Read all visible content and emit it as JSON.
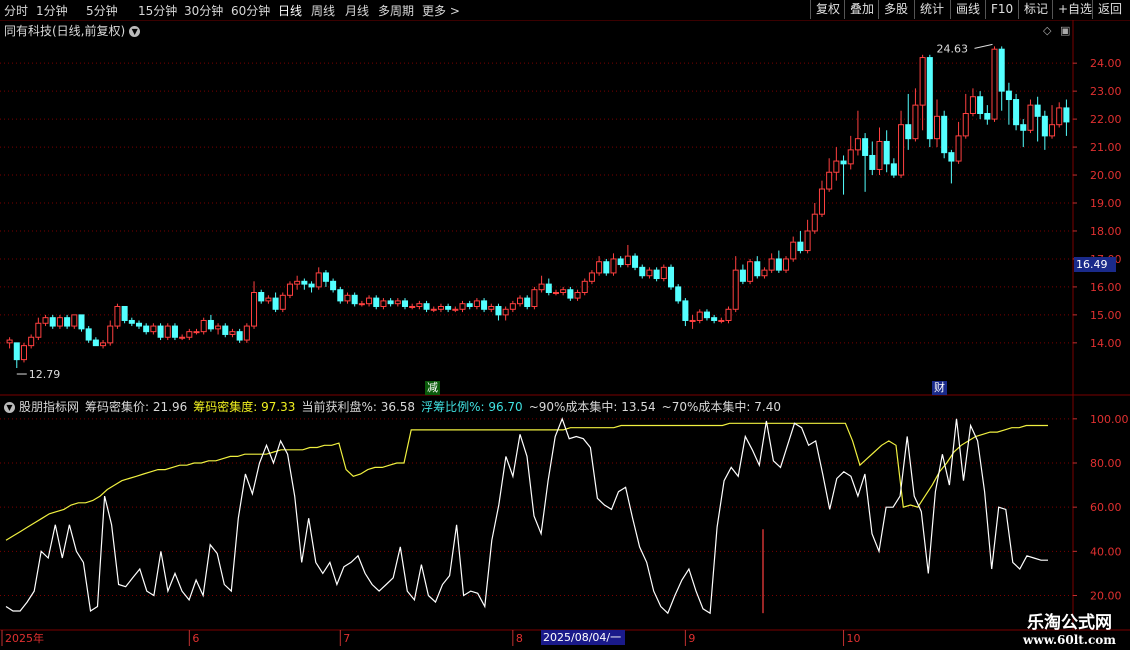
{
  "toolbar": {
    "periods": [
      "分时",
      "1分钟",
      "5分钟",
      "15分钟",
      "30分钟",
      "60分钟",
      "日线",
      "周线",
      "月线",
      "多周期",
      "更多 >"
    ],
    "active_index": 6,
    "right_buttons": [
      "复权",
      "叠加",
      "多股",
      "统计",
      "画线",
      "F10",
      "标记",
      "+自选",
      "返回"
    ]
  },
  "header": {
    "title": "同有科技(日线,前复权)",
    "chevron": "chevron-down-icon"
  },
  "markers": {
    "jian": "减",
    "cai": "财",
    "high_label": "24.63",
    "low_label": "12.79"
  },
  "price_tag": "16.49",
  "indicator": {
    "name": "股朋指标网",
    "items": [
      {
        "label": "筹码密集价: 21.96",
        "color": "#d8d8d8"
      },
      {
        "label": "筹码密集度: 97.33",
        "color": "#f0f020"
      },
      {
        "label": "当前获利盘%: 36.58",
        "color": "#d8d8d8"
      },
      {
        "label": "浮筹比例%: 96.70",
        "color": "#40e0e0"
      },
      {
        "label": "~90%成本集中: 13.54",
        "color": "#d8d8d8"
      },
      {
        "label": "~70%成本集中: 7.40",
        "color": "#d8d8d8"
      }
    ]
  },
  "date_box": "2025/08/04/一",
  "watermark": {
    "line1": "乐淘公式网",
    "line2": "www.60lt.com"
  },
  "colors": {
    "up": "#ff4040",
    "down": "#54ffff",
    "grid": "#7a0000",
    "yellow": "#f0f040",
    "white": "#ffffff"
  },
  "chart_data": [
    {
      "type": "candlestick",
      "title": "同有科技(日线,前复权)",
      "y_ticks": [
        14.0,
        15.0,
        16.0,
        17.0,
        18.0,
        19.0,
        20.0,
        21.0,
        22.0,
        23.0,
        24.0
      ],
      "ylim": [
        12.6,
        24.9
      ],
      "x_ticks": [
        "2025年",
        "6",
        "7",
        "8",
        "9",
        "10"
      ],
      "x_tick_index": [
        0,
        25,
        46,
        70,
        94,
        116
      ],
      "candles": [
        [
          14.0,
          14.1,
          13.8,
          14.2
        ],
        [
          14.0,
          13.4,
          13.1,
          14.0
        ],
        [
          13.4,
          13.9,
          13.3,
          14.0
        ],
        [
          13.9,
          14.2,
          13.8,
          14.3
        ],
        [
          14.2,
          14.7,
          14.1,
          14.9
        ],
        [
          14.7,
          14.9,
          14.6,
          15.0
        ],
        [
          14.9,
          14.6,
          14.5,
          15.0
        ],
        [
          14.6,
          14.9,
          14.5,
          15.0
        ],
        [
          14.9,
          14.6,
          14.5,
          15.0
        ],
        [
          14.6,
          15.0,
          14.5,
          15.0
        ],
        [
          15.0,
          14.5,
          14.4,
          15.0
        ],
        [
          14.5,
          14.1,
          14.0,
          14.6
        ],
        [
          14.1,
          13.9,
          13.9,
          14.2
        ],
        [
          13.9,
          14.0,
          13.8,
          14.1
        ],
        [
          14.0,
          14.6,
          13.9,
          14.8
        ],
        [
          14.6,
          15.3,
          14.5,
          15.4
        ],
        [
          15.3,
          14.8,
          14.7,
          15.3
        ],
        [
          14.8,
          14.7,
          14.6,
          14.9
        ],
        [
          14.7,
          14.6,
          14.5,
          14.8
        ],
        [
          14.6,
          14.4,
          14.3,
          14.7
        ],
        [
          14.4,
          14.6,
          14.3,
          14.7
        ],
        [
          14.6,
          14.2,
          14.1,
          14.7
        ],
        [
          14.2,
          14.6,
          14.1,
          14.7
        ],
        [
          14.6,
          14.2,
          14.1,
          14.7
        ],
        [
          14.2,
          14.2,
          14.1,
          14.3
        ],
        [
          14.2,
          14.4,
          14.1,
          14.5
        ],
        [
          14.4,
          14.4,
          14.3,
          14.5
        ],
        [
          14.4,
          14.8,
          14.3,
          14.9
        ],
        [
          14.8,
          14.5,
          14.4,
          15.0
        ],
        [
          14.5,
          14.6,
          14.3,
          14.7
        ],
        [
          14.6,
          14.3,
          14.2,
          14.7
        ],
        [
          14.3,
          14.4,
          14.2,
          14.5
        ],
        [
          14.4,
          14.1,
          14.0,
          14.5
        ],
        [
          14.1,
          14.6,
          14.0,
          14.7
        ],
        [
          14.6,
          15.8,
          14.5,
          16.2
        ],
        [
          15.8,
          15.5,
          15.4,
          15.9
        ],
        [
          15.5,
          15.6,
          15.4,
          15.7
        ],
        [
          15.6,
          15.2,
          15.1,
          15.8
        ],
        [
          15.2,
          15.7,
          15.1,
          15.8
        ],
        [
          15.7,
          16.1,
          15.6,
          16.2
        ],
        [
          16.1,
          16.2,
          15.9,
          16.4
        ],
        [
          16.2,
          16.1,
          15.9,
          16.3
        ],
        [
          16.1,
          16.0,
          15.8,
          16.2
        ],
        [
          16.0,
          16.5,
          15.9,
          16.7
        ],
        [
          16.5,
          16.2,
          16.0,
          16.6
        ],
        [
          16.2,
          15.9,
          15.8,
          16.3
        ],
        [
          15.9,
          15.5,
          15.4,
          16.0
        ],
        [
          15.5,
          15.7,
          15.4,
          15.8
        ],
        [
          15.7,
          15.4,
          15.3,
          15.8
        ],
        [
          15.4,
          15.4,
          15.3,
          15.5
        ],
        [
          15.4,
          15.6,
          15.3,
          15.7
        ],
        [
          15.6,
          15.3,
          15.2,
          15.7
        ],
        [
          15.3,
          15.5,
          15.2,
          15.6
        ],
        [
          15.5,
          15.4,
          15.3,
          15.6
        ],
        [
          15.4,
          15.5,
          15.3,
          15.6
        ],
        [
          15.5,
          15.3,
          15.2,
          15.6
        ],
        [
          15.3,
          15.3,
          15.2,
          15.4
        ],
        [
          15.3,
          15.4,
          15.2,
          15.5
        ],
        [
          15.4,
          15.2,
          15.1,
          15.5
        ],
        [
          15.2,
          15.2,
          15.1,
          15.3
        ],
        [
          15.2,
          15.3,
          15.1,
          15.4
        ],
        [
          15.3,
          15.2,
          15.1,
          15.4
        ],
        [
          15.2,
          15.2,
          15.1,
          15.3
        ],
        [
          15.2,
          15.4,
          15.1,
          15.5
        ],
        [
          15.4,
          15.3,
          15.2,
          15.5
        ],
        [
          15.3,
          15.5,
          15.2,
          15.6
        ],
        [
          15.5,
          15.2,
          15.1,
          15.6
        ],
        [
          15.2,
          15.3,
          15.1,
          15.4
        ],
        [
          15.3,
          15.0,
          14.8,
          15.4
        ],
        [
          15.0,
          15.2,
          14.8,
          15.3
        ],
        [
          15.2,
          15.4,
          15.1,
          15.5
        ],
        [
          15.4,
          15.6,
          15.3,
          15.7
        ],
        [
          15.6,
          15.3,
          15.2,
          15.7
        ],
        [
          15.3,
          15.9,
          15.2,
          16.0
        ],
        [
          15.9,
          16.1,
          15.8,
          16.4
        ],
        [
          16.1,
          15.8,
          15.7,
          16.3
        ],
        [
          15.8,
          15.8,
          15.7,
          15.9
        ],
        [
          15.8,
          15.9,
          15.7,
          16.0
        ],
        [
          15.9,
          15.6,
          15.5,
          16.0
        ],
        [
          15.6,
          15.8,
          15.5,
          15.9
        ],
        [
          15.8,
          16.2,
          15.7,
          16.3
        ],
        [
          16.2,
          16.5,
          16.1,
          16.6
        ],
        [
          16.5,
          16.9,
          16.4,
          17.1
        ],
        [
          16.9,
          16.5,
          16.4,
          17.0
        ],
        [
          16.5,
          17.0,
          16.4,
          17.2
        ],
        [
          17.0,
          16.8,
          16.7,
          17.1
        ],
        [
          16.8,
          17.1,
          16.7,
          17.5
        ],
        [
          17.1,
          16.7,
          16.6,
          17.2
        ],
        [
          16.7,
          16.4,
          16.3,
          16.8
        ],
        [
          16.4,
          16.6,
          16.3,
          16.7
        ],
        [
          16.6,
          16.3,
          16.2,
          16.7
        ],
        [
          16.3,
          16.7,
          16.2,
          16.8
        ],
        [
          16.7,
          16.0,
          15.9,
          16.8
        ],
        [
          16.0,
          15.5,
          15.4,
          16.1
        ],
        [
          15.5,
          14.8,
          14.6,
          15.6
        ],
        [
          14.8,
          14.8,
          14.5,
          15.0
        ],
        [
          14.8,
          15.1,
          14.7,
          15.2
        ],
        [
          15.1,
          14.9,
          14.8,
          15.2
        ],
        [
          14.9,
          14.8,
          14.7,
          15.0
        ],
        [
          14.8,
          14.8,
          14.7,
          14.9
        ],
        [
          14.8,
          15.2,
          14.7,
          15.3
        ],
        [
          15.2,
          16.6,
          15.1,
          17.1
        ],
        [
          16.6,
          16.2,
          16.1,
          16.8
        ],
        [
          16.2,
          16.9,
          16.1,
          17.0
        ],
        [
          16.9,
          16.4,
          16.3,
          17.1
        ],
        [
          16.4,
          16.6,
          16.3,
          16.7
        ],
        [
          16.6,
          17.0,
          16.5,
          17.2
        ],
        [
          17.0,
          16.6,
          16.5,
          17.3
        ],
        [
          16.6,
          17.0,
          16.5,
          17.1
        ],
        [
          17.0,
          17.6,
          16.9,
          17.8
        ],
        [
          17.6,
          17.3,
          17.2,
          18.0
        ],
        [
          17.3,
          18.0,
          17.2,
          18.4
        ],
        [
          18.0,
          18.6,
          17.9,
          19.0
        ],
        [
          18.6,
          19.5,
          18.5,
          19.8
        ],
        [
          19.5,
          20.1,
          19.4,
          20.6
        ],
        [
          20.1,
          20.5,
          19.8,
          21.0
        ],
        [
          20.5,
          20.4,
          19.3,
          20.7
        ],
        [
          20.4,
          20.9,
          20.2,
          21.4
        ],
        [
          20.9,
          21.3,
          20.7,
          22.3
        ],
        [
          21.3,
          20.7,
          19.4,
          21.5
        ],
        [
          20.7,
          20.2,
          20.0,
          21.2
        ],
        [
          20.2,
          21.2,
          20.0,
          21.7
        ],
        [
          21.2,
          20.4,
          20.1,
          21.6
        ],
        [
          20.4,
          20.0,
          19.9,
          20.6
        ],
        [
          20.0,
          21.8,
          19.9,
          22.3
        ],
        [
          21.8,
          21.3,
          20.9,
          22.9
        ],
        [
          21.3,
          22.5,
          21.2,
          23.1
        ],
        [
          22.5,
          24.2,
          21.6,
          24.3
        ],
        [
          24.2,
          21.3,
          21.0,
          24.3
        ],
        [
          21.3,
          22.1,
          21.0,
          22.7
        ],
        [
          22.1,
          20.8,
          20.6,
          22.3
        ],
        [
          20.8,
          20.5,
          19.7,
          20.9
        ],
        [
          20.5,
          21.4,
          20.4,
          21.9
        ],
        [
          21.4,
          22.2,
          21.3,
          22.9
        ],
        [
          22.2,
          22.8,
          22.1,
          23.1
        ],
        [
          22.8,
          22.2,
          22.0,
          23.0
        ],
        [
          22.2,
          22.0,
          21.8,
          22.5
        ],
        [
          22.0,
          24.5,
          21.9,
          24.6
        ],
        [
          24.5,
          23.0,
          22.3,
          24.6
        ],
        [
          23.0,
          22.7,
          21.8,
          23.3
        ],
        [
          22.7,
          21.8,
          21.6,
          22.9
        ],
        [
          21.8,
          21.6,
          21.0,
          22.0
        ],
        [
          21.6,
          22.5,
          21.5,
          22.7
        ],
        [
          22.5,
          22.1,
          21.2,
          22.8
        ],
        [
          22.1,
          21.4,
          20.9,
          22.3
        ],
        [
          21.4,
          21.8,
          21.3,
          22.5
        ],
        [
          21.8,
          22.4,
          21.7,
          22.6
        ],
        [
          22.4,
          21.9,
          21.4,
          22.7
        ]
      ]
    },
    {
      "type": "line",
      "title": "股朋指标网",
      "y_ticks": [
        20.0,
        40.0,
        60.0,
        80.0,
        100.0
      ],
      "ylim": [
        8,
        104
      ],
      "series": [
        {
          "name": "筹码密集度",
          "color": "#f0f040",
          "values": [
            45,
            47,
            49,
            51,
            53,
            55,
            57,
            58,
            59,
            61,
            62,
            62,
            63,
            65,
            68,
            70,
            72,
            73,
            74,
            75,
            76,
            77,
            77,
            78,
            79,
            79,
            80,
            80,
            81,
            81,
            82,
            83,
            83,
            84,
            84,
            84,
            84,
            85,
            86,
            86,
            86,
            86,
            87,
            87,
            88,
            88,
            89,
            77,
            74,
            75,
            77,
            78,
            78,
            79,
            80,
            80,
            95,
            95,
            95,
            95,
            95,
            95,
            95,
            95,
            95,
            95,
            95,
            95,
            95,
            95,
            95,
            95,
            95,
            95,
            95,
            95,
            95,
            95,
            96,
            96,
            96,
            96,
            96,
            96,
            96,
            97,
            97,
            97,
            97,
            97,
            97,
            97,
            97,
            97,
            97,
            97,
            97,
            97,
            97,
            97,
            98,
            98,
            98,
            98,
            98,
            98,
            98,
            98,
            98,
            98,
            98,
            98,
            98,
            98,
            98,
            98,
            98,
            90,
            79,
            82,
            85,
            88,
            90,
            88,
            60,
            61,
            60,
            65,
            70,
            76,
            80,
            85,
            88,
            90,
            92,
            93,
            94,
            94,
            95,
            96,
            96,
            97,
            97,
            97,
            97
          ]
        },
        {
          "name": "当前获利盘%",
          "color": "#ffffff",
          "values": [
            15,
            13,
            13,
            17,
            22,
            40,
            37,
            52,
            37,
            52,
            40,
            35,
            13,
            15,
            65,
            52,
            25,
            24,
            28,
            32,
            22,
            20,
            40,
            22,
            30,
            22,
            18,
            27,
            20,
            43,
            39,
            25,
            22,
            55,
            75,
            66,
            80,
            88,
            80,
            90,
            84,
            65,
            35,
            55,
            35,
            30,
            35,
            25,
            33,
            35,
            38,
            30,
            25,
            22,
            25,
            28,
            42,
            22,
            18,
            34,
            20,
            17,
            25,
            29,
            52,
            20,
            22,
            21,
            15,
            45,
            61,
            83,
            74,
            93,
            83,
            56,
            48,
            72,
            92,
            100,
            91,
            92,
            91,
            87,
            64,
            61,
            59,
            67,
            69,
            55,
            42,
            35,
            22,
            15,
            12,
            20,
            27,
            32,
            22,
            14,
            12,
            51,
            72,
            78,
            74,
            92,
            86,
            79,
            99,
            81,
            78,
            88,
            98,
            96,
            88,
            90,
            75,
            59,
            73,
            76,
            74,
            65,
            75,
            48,
            40,
            60,
            60,
            65,
            92,
            65,
            58,
            30,
            67,
            84,
            70,
            100,
            72,
            97,
            90,
            67,
            32,
            60,
            59,
            35,
            32,
            38,
            37,
            36,
            36
          ]
        },
        {
          "name": "浮筹比例%",
          "color": "#ff4040",
          "values": [
            50
          ]
        }
      ]
    }
  ]
}
